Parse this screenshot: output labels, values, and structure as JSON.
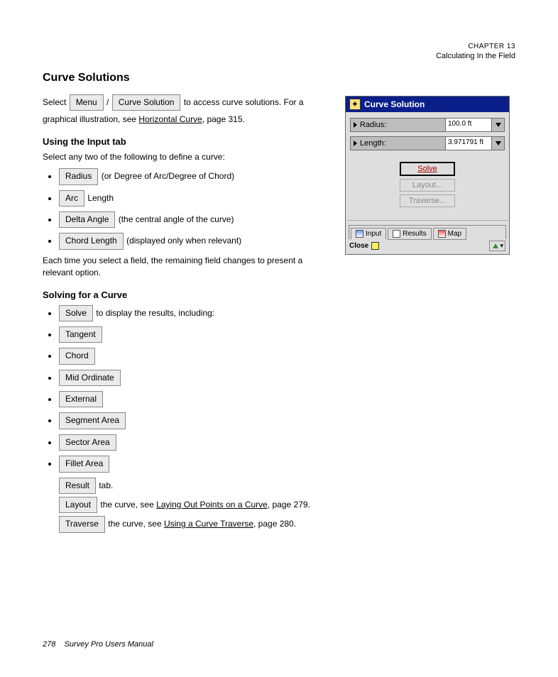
{
  "header": {
    "chapter_label": "CHAPTER 13",
    "chapter_title": "Calculating In the Field"
  },
  "title": "Curve Solutions",
  "intro_1_a": "Select ",
  "intro_1_b": " / ",
  "intro_1_c": " to access curve solutions. For a",
  "intro_2_a": "graphical illustration, see ",
  "intro_2_b": ", page 315.",
  "menu_btn": "Menu",
  "curve_btn": "Curve Solution",
  "horiz_link": "Horizontal Curve",
  "sec1_h": "Using the Input tab",
  "sec1_p": "Select any two of the following to define a curve:",
  "b_radius": "Radius",
  "b_radius_desc": " (or Degree of Arc/Degree of Chord)",
  "b_arc": "Arc",
  "b_arc_desc": " Length",
  "b_delta": "Delta Angle",
  "b_delta_desc": " (the central angle of the curve)",
  "b_chord": "Chord Length",
  "b_chord_desc": " (displayed only when relevant)",
  "sec1_p2": "Each time you select a field, the remaining field changes to present a relevant option.",
  "sec2_h": "Solving for a Curve",
  "btn_solve": "Solve",
  "btn_tangent": "Tangent",
  "btn_chord2": "Chord",
  "btn_mido": "Mid Ordinate",
  "btn_ext": "External",
  "btn_segment": "Segment Area",
  "btn_sector": "Sector Area",
  "btn_fillet": "Fillet Area",
  "sec2_li1": " to display the results, including:",
  "btn_result_tab": "Result",
  "sec2_p_tab": " tab.",
  "btn_layout": "Layout",
  "sec2_layout_a": " the curve, see ",
  "sec2_layout_link": "Laying Out Points on a Curve",
  "sec2_layout_b": ", page 279.",
  "btn_traverse": "Traverse",
  "sec2_trav_a": " the curve, see ",
  "sec2_trav_link": "Using a Curve Traverse",
  "sec2_trav_b": ", page 280.",
  "dlg": {
    "title": "Curve Solution",
    "r_label": "Radius:",
    "r_val": "100.0 ft",
    "l_label": "Length:",
    "l_val": "3.971791 ft",
    "solve": "Solve",
    "layout": "Layout...",
    "traverse": "Traverse...",
    "tab_input": "Input",
    "tab_results": "Results",
    "tab_map": "Map",
    "close": "Close"
  },
  "footer": "Survey Pro Users Manual",
  "pagenum": "278"
}
